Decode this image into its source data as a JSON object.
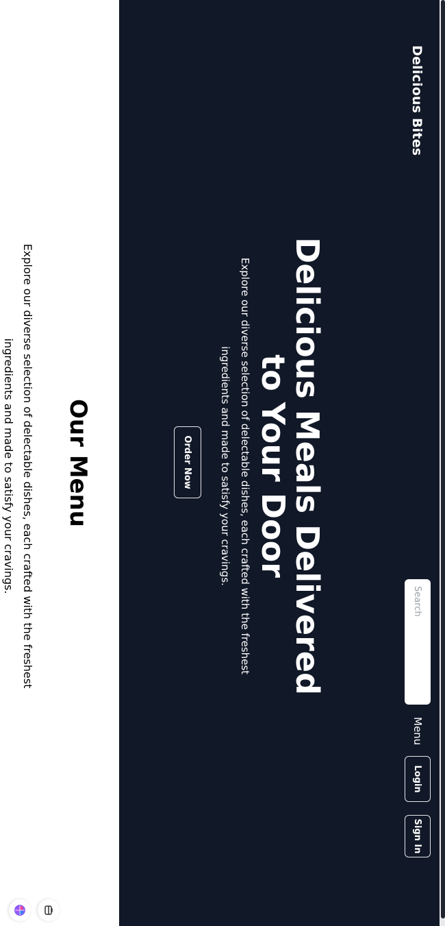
{
  "navbar": {
    "brand": "Delicious Bites",
    "search_placeholder": "Search",
    "menu_label": "Menu",
    "login_label": "Login",
    "signin_label": "Sign In"
  },
  "hero": {
    "title": "Delicious Meals Delivered to Your Door",
    "subtitle": "Explore our diverse selection of delectable dishes, each crafted with the freshest ingredients and made to satisfy your cravings.",
    "cta_label": "Order Now"
  },
  "menu_section": {
    "title": "Our Menu",
    "subtitle": "Explore our diverse selection of delectable dishes, each crafted with the freshest ingredients and made to satisfy your cravings."
  },
  "icons": {
    "brain": "brain-icon",
    "tool": "toolbox-icon"
  },
  "colors": {
    "dark_background": "#111827",
    "page_background": "#ffffff",
    "text_light": "#ffffff",
    "text_dark": "#000000"
  }
}
